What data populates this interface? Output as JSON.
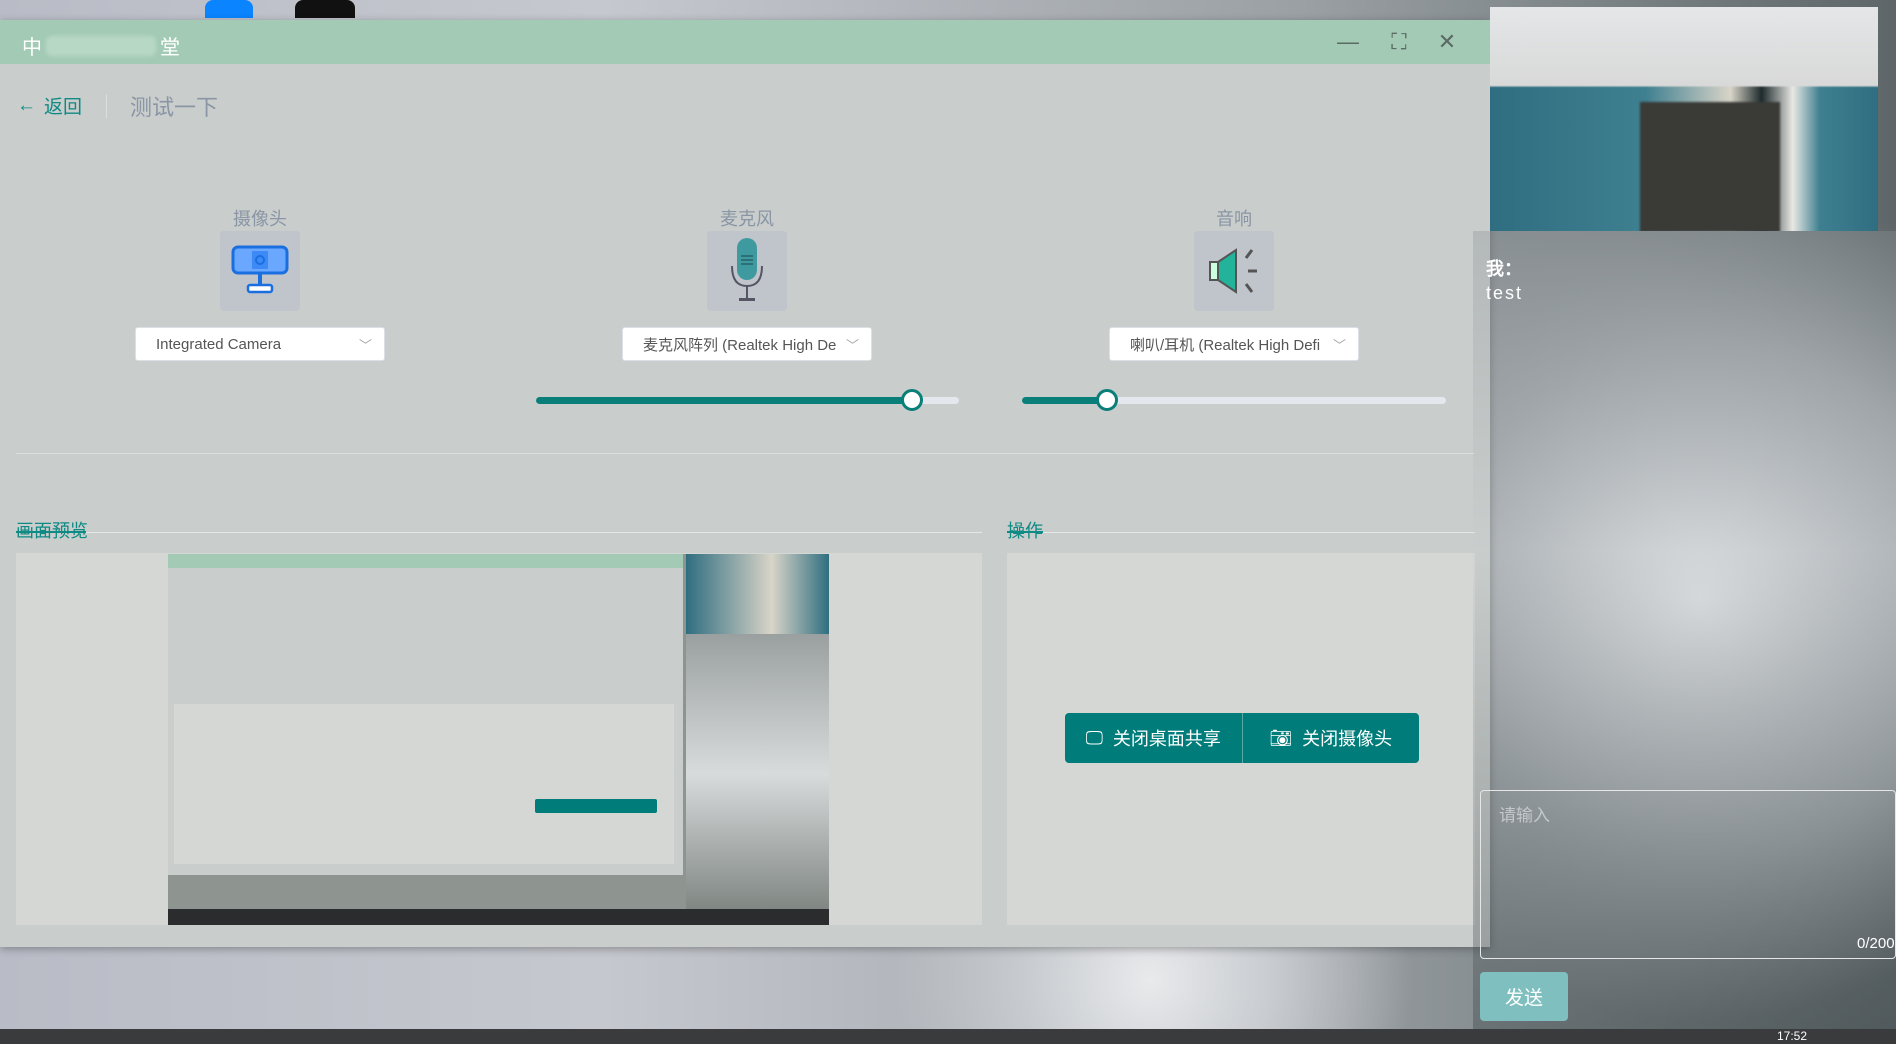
{
  "window": {
    "title_start": "中",
    "title_end": "堂",
    "minimize_icon": "minimize-icon",
    "maximize_icon": "maximize-icon",
    "close_icon": "close-icon"
  },
  "nav": {
    "back_label": "返回",
    "page_title": "测试一下"
  },
  "devices": [
    {
      "label": "摄像头",
      "icon": "webcam-icon",
      "selected": "Integrated Camera"
    },
    {
      "label": "麦克风",
      "icon": "microphone-icon",
      "selected": "麦克风阵列 (Realtek High De",
      "volume": 0.89
    },
    {
      "label": "音响",
      "icon": "speaker-icon",
      "selected": "喇叭/耳机 (Realtek High Defi",
      "volume": 0.2
    }
  ],
  "sections": {
    "preview": "画面预览",
    "operations": "操作"
  },
  "actions": {
    "stop_share": "关闭桌面共享",
    "stop_camera": "关闭摄像头"
  },
  "chat": {
    "sender": "我：",
    "message": "test",
    "placeholder": "请输入",
    "counter": "0/200",
    "send": "发送"
  },
  "taskbar": {
    "clock": "17:52"
  },
  "colors": {
    "accent": "#007d7a",
    "titlebar": "#a3cab5",
    "send": "#7fbfbf"
  }
}
